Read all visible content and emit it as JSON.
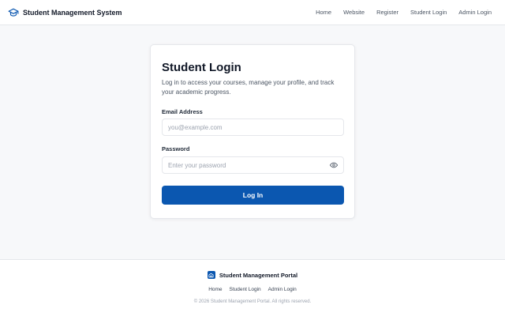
{
  "header": {
    "brand_title": "Student Management System",
    "nav": [
      "Home",
      "Website",
      "Register",
      "Student Login",
      "Admin Login"
    ]
  },
  "login": {
    "title": "Student Login",
    "subtitle": "Log in to access your courses, manage your profile, and track your academic progress.",
    "email_label": "Email Address",
    "email_placeholder": "you@example.com",
    "email_value": "",
    "password_label": "Password",
    "password_placeholder": "Enter your password",
    "password_value": "",
    "submit_label": "Log In"
  },
  "footer": {
    "title": "Student Management Portal",
    "links": [
      "Home",
      "Student Login",
      "Admin Login"
    ],
    "copyright": "© 2026 Student Management Portal. All rights reserved."
  },
  "colors": {
    "primary": "#0b57b0",
    "background": "#f7f8fa",
    "surface": "#ffffff",
    "border": "#e5e7eb"
  },
  "icons": {
    "brand": "graduation-cap-icon",
    "password_toggle": "eye-icon",
    "footer_logo": "building-icon"
  }
}
